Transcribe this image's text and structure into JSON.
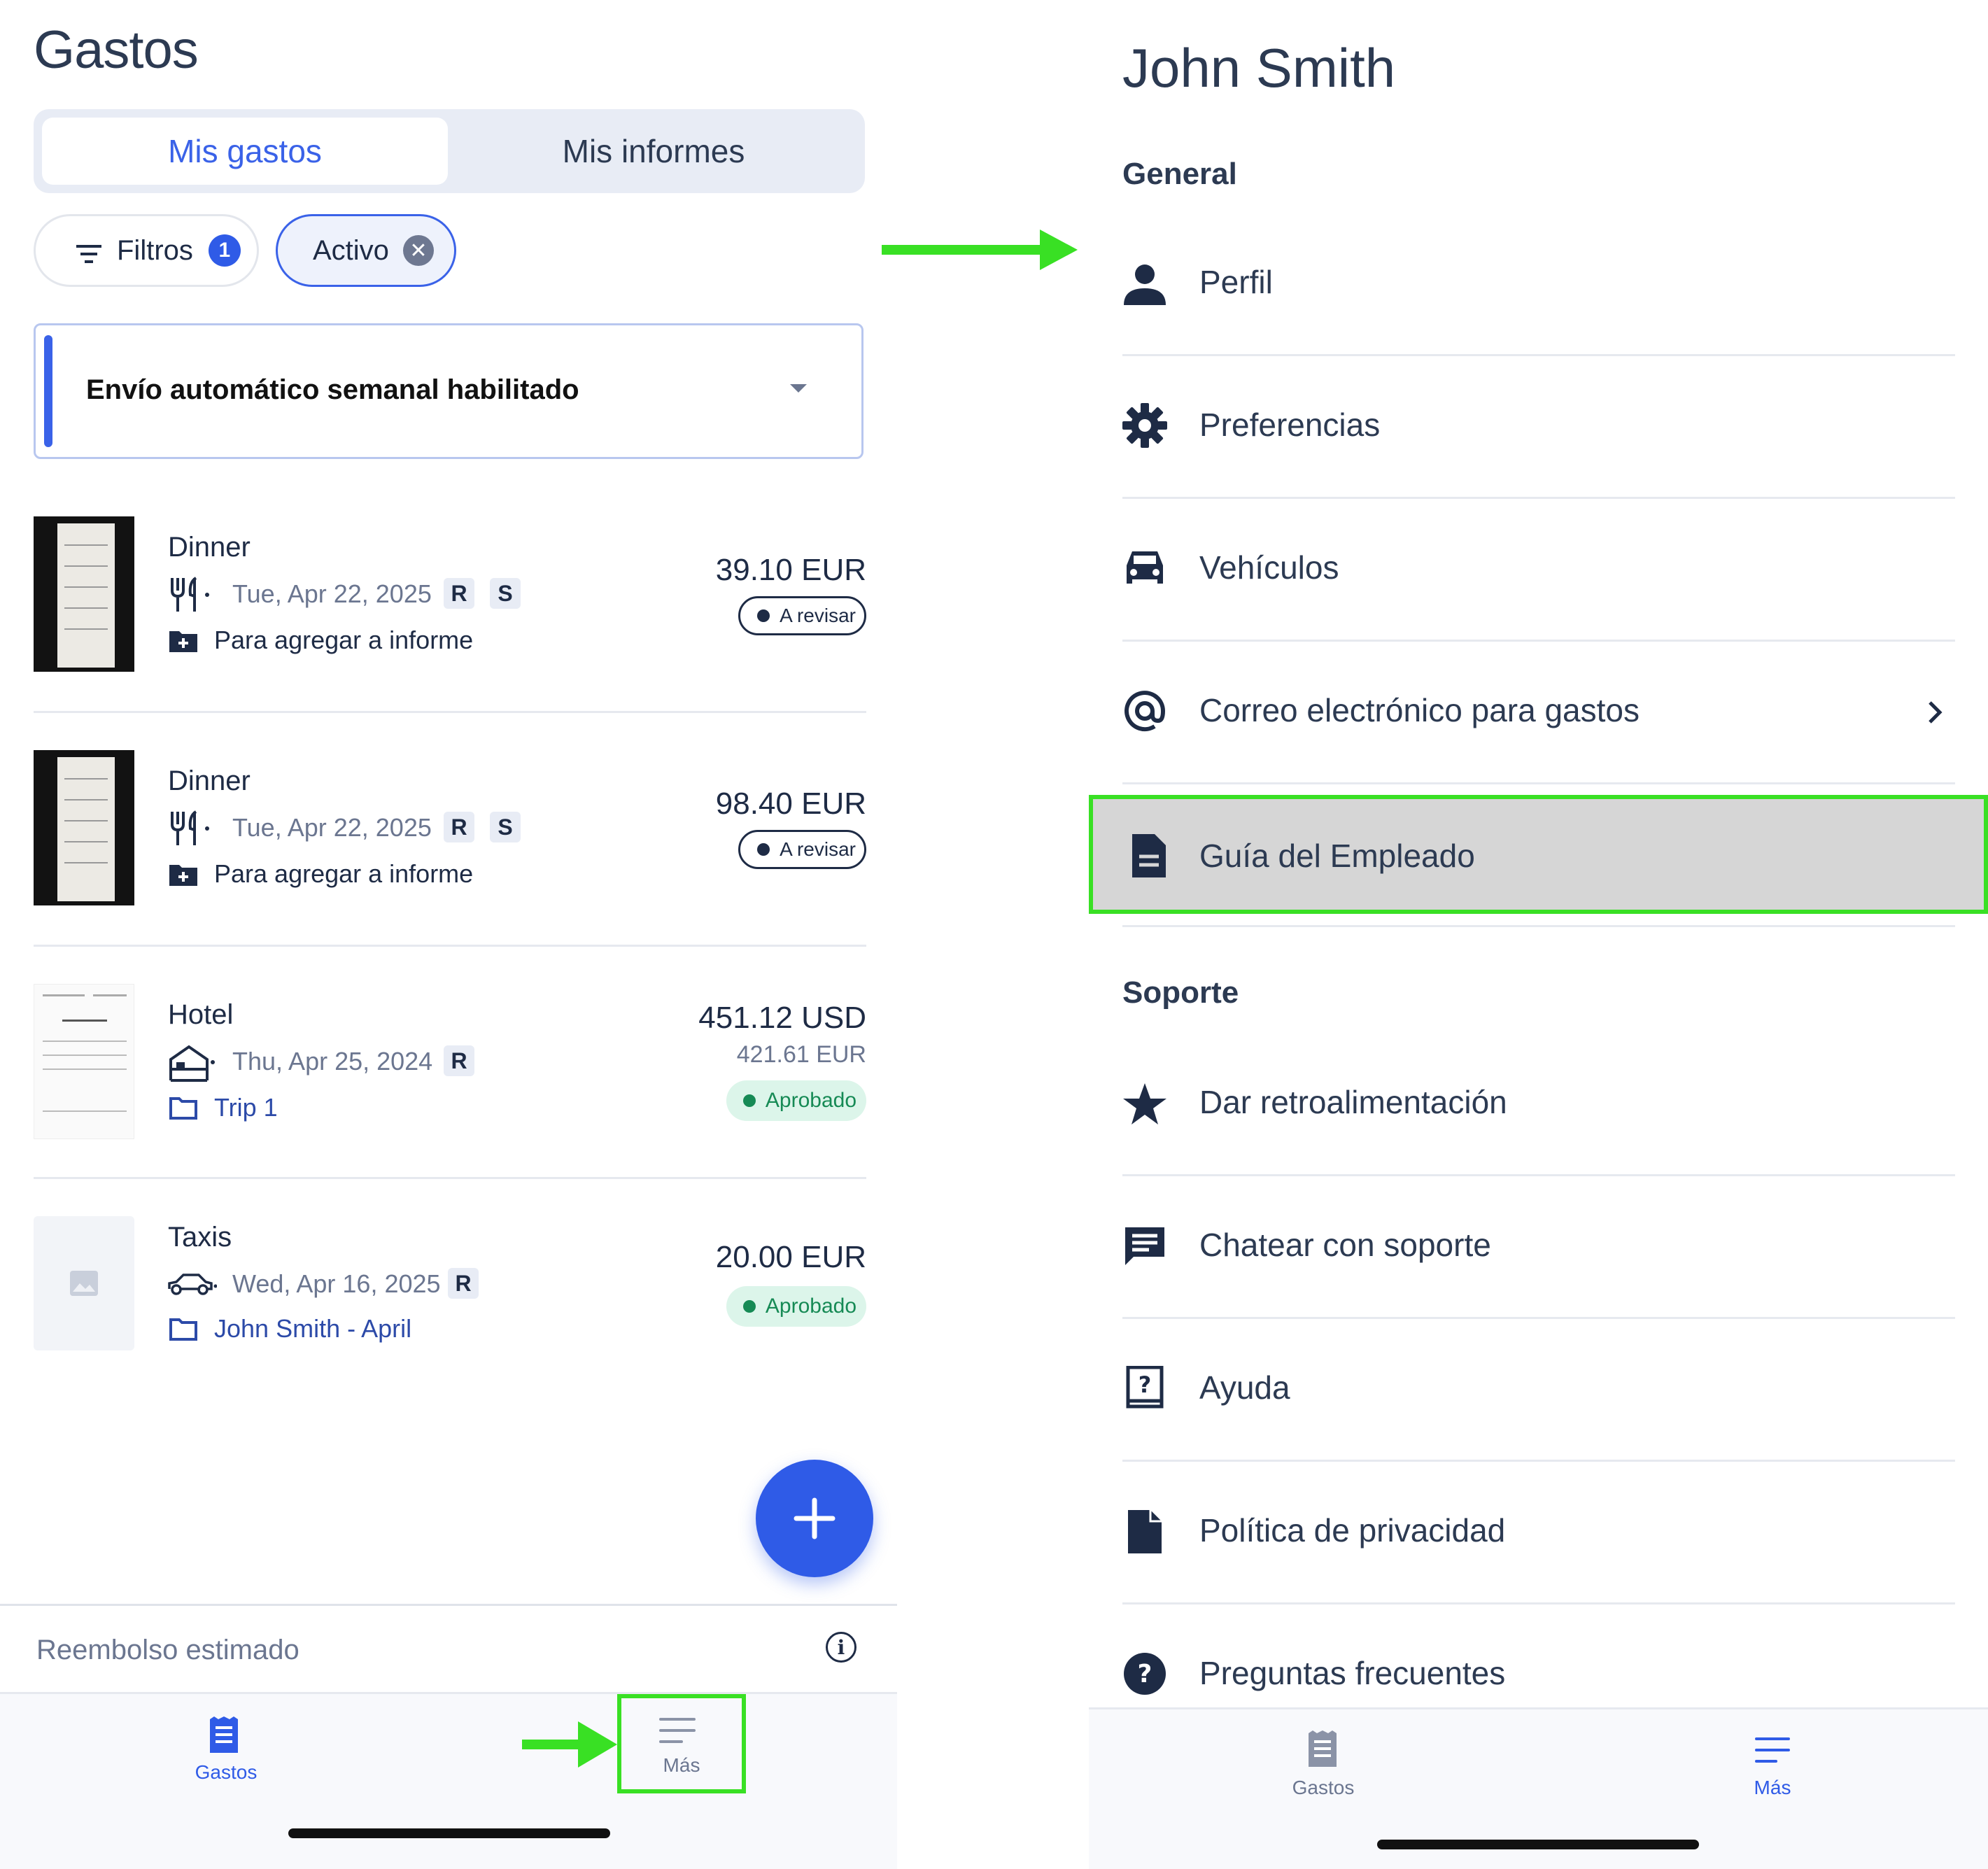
{
  "left": {
    "title": "Gastos",
    "segment": {
      "active": "Mis gastos",
      "inactive": "Mis informes"
    },
    "filters": {
      "label": "Filtros",
      "count": "1"
    },
    "active_chip": "Activo",
    "banner": "Envío automático semanal habilitado",
    "expenses": [
      {
        "title": "Dinner",
        "date": "Tue, Apr 22, 2025",
        "tags": [
          "R",
          "S"
        ],
        "folder": "Para agregar a informe",
        "amount": "39.10 EUR",
        "status": "A revisar"
      },
      {
        "title": "Dinner",
        "date": "Tue, Apr 22, 2025",
        "tags": [
          "R",
          "S"
        ],
        "folder": "Para agregar a informe",
        "amount": "98.40 EUR",
        "status": "A revisar"
      },
      {
        "title": "Hotel",
        "date": "Thu, Apr 25, 2024",
        "tags": [
          "R"
        ],
        "folder": "Trip 1",
        "amount": "451.12 USD",
        "amount2": "421.61  EUR",
        "status": "Aprobado"
      },
      {
        "title": "Taxis",
        "date": "Wed, Apr 16, 2025",
        "tags": [
          "R"
        ],
        "folder": "John Smith - April",
        "amount": "20.00 EUR",
        "status": "Aprobado"
      }
    ],
    "reimbursement": "Reembolso estimado",
    "tabs": {
      "gastos": "Gastos",
      "mas": "Más"
    }
  },
  "right": {
    "name": "John Smith",
    "general_title": "General",
    "general": [
      "Perfil",
      "Preferencias",
      "Vehículos",
      "Correo electrónico para gastos",
      "Guía del Empleado"
    ],
    "support_title": "Soporte",
    "support": [
      "Dar retroalimentación",
      "Chatear con soporte",
      "Ayuda",
      "Política de privacidad",
      "Preguntas frecuentes"
    ],
    "tabs": {
      "gastos": "Gastos",
      "mas": "Más"
    }
  },
  "colors": {
    "accent": "#2f5be7",
    "highlight": "#39e024",
    "approved": "#168a55"
  }
}
